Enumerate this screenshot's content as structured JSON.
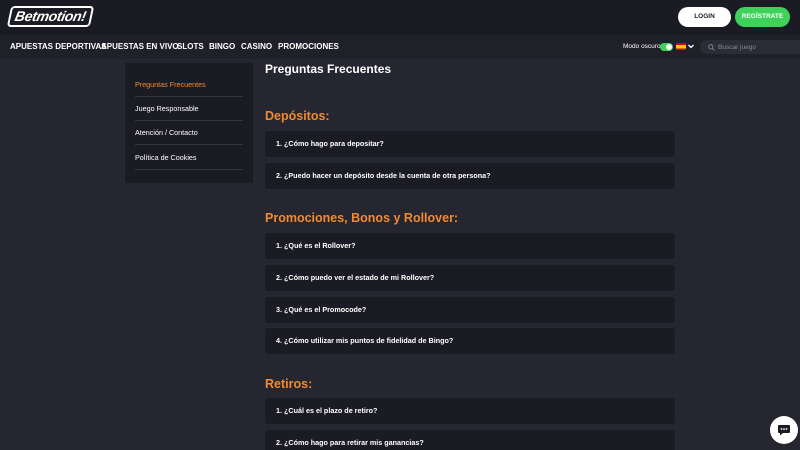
{
  "header": {
    "logo_text": "Betmotion!",
    "login_label": "LOGIN",
    "register_label": "REGÍSTRATE"
  },
  "nav": {
    "items": [
      {
        "label": "APUESTAS DEPORTIVAS"
      },
      {
        "label": "APUESTAS EN VIVO"
      },
      {
        "label": "SLOTS"
      },
      {
        "label": "BINGO"
      },
      {
        "label": "CASINO"
      },
      {
        "label": "PROMOCIONES"
      }
    ],
    "dark_mode_label": "Modo oscuro",
    "dark_mode_on": true,
    "language_flag": "spain-flag",
    "search_placeholder": "Buscar juego"
  },
  "sidebar": {
    "items": [
      {
        "label": "Preguntas Frecuentes",
        "active": true
      },
      {
        "label": "Juego Responsable",
        "active": false
      },
      {
        "label": "Atención / Contacto",
        "active": false
      },
      {
        "label": "Política de Cookies",
        "active": false
      }
    ]
  },
  "main": {
    "title": "Preguntas Frecuentes",
    "sections": [
      {
        "title": "Depósitos:",
        "questions": [
          "1. ¿Cómo hago para depositar?",
          "2. ¿Puedo hacer un depósito desde la cuenta de otra persona?"
        ]
      },
      {
        "title": "Promociones, Bonos y Rollover:",
        "questions": [
          "1. ¿Qué es el Rollover?",
          "2. ¿Cómo puedo ver el estado de mi Rollover?",
          "3. ¿Qué es el Promocode?",
          "4. ¿Cómo utilizar mis puntos de fidelidad de Bingo?"
        ]
      },
      {
        "title": "Retiros:",
        "questions": [
          "1. ¿Cuál es el plazo de retiro?",
          "2. ¿Cómo hago para retirar mis ganancias?"
        ]
      }
    ]
  },
  "colors": {
    "accent": "#f18a30",
    "register": "#3fd25b",
    "background": "#25262f",
    "panel": "#1b1c23"
  },
  "chat": {
    "icon": "chat-icon"
  }
}
